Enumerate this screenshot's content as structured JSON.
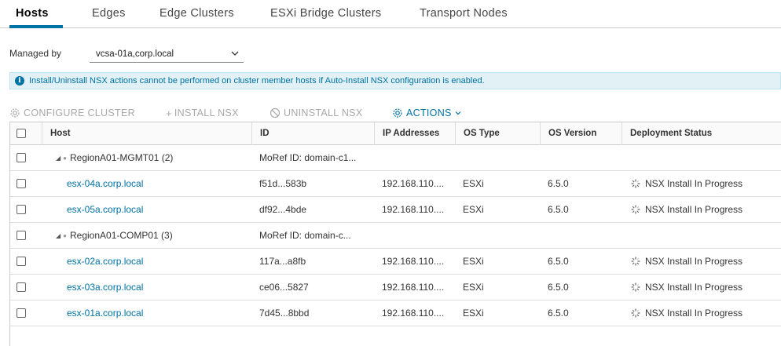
{
  "tabs": [
    {
      "label": "Hosts",
      "active": true
    },
    {
      "label": "Edges",
      "active": false
    },
    {
      "label": "Edge Clusters",
      "active": false
    },
    {
      "label": "ESXi Bridge Clusters",
      "active": false
    },
    {
      "label": "Transport Nodes",
      "active": false
    }
  ],
  "managed_by": {
    "label": "Managed by",
    "value": "vcsa-01a,corp.local",
    "chevron_icon": "chevron-down-icon"
  },
  "banner": {
    "icon": "info-icon",
    "message": "Install/Uninstall NSX actions cannot be performed on cluster member hosts if Auto-Install NSX configuration is enabled."
  },
  "toolbar": {
    "configure_cluster": "CONFIGURE CLUSTER",
    "install_nsx": "INSTALL NSX",
    "uninstall_nsx": "UNINSTALL NSX",
    "actions": "ACTIONS"
  },
  "columns": {
    "host": "Host",
    "id": "ID",
    "ip": "IP Addresses",
    "os_type": "OS Type",
    "os_version": "OS Version",
    "deployment_status": "Deployment Status"
  },
  "rows": [
    {
      "kind": "cluster",
      "host": "RegionA01-MGMT01 (2)",
      "id": "MoRef ID: domain-c1...",
      "ip": "",
      "os_type": "",
      "os_version": "",
      "status": ""
    },
    {
      "kind": "host",
      "host": "esx-04a.corp.local",
      "id": "f51d...583b",
      "ip": "192.168.110....",
      "os_type": "ESXi",
      "os_version": "6.5.0",
      "status": "NSX Install In Progress"
    },
    {
      "kind": "host",
      "host": "esx-05a.corp.local",
      "id": "df92...4bde",
      "ip": "192.168.110....",
      "os_type": "ESXi",
      "os_version": "6.5.0",
      "status": "NSX Install In Progress"
    },
    {
      "kind": "cluster",
      "host": "RegionA01-COMP01 (3)",
      "id": "MoRef ID: domain-c...",
      "ip": "",
      "os_type": "",
      "os_version": "",
      "status": ""
    },
    {
      "kind": "host",
      "host": "esx-02a.corp.local",
      "id": "117a...a8fb",
      "ip": "192.168.110....",
      "os_type": "ESXi",
      "os_version": "6.5.0",
      "status": "NSX Install In Progress"
    },
    {
      "kind": "host",
      "host": "esx-03a.corp.local",
      "id": "ce06...5827",
      "ip": "192.168.110....",
      "os_type": "ESXi",
      "os_version": "6.5.0",
      "status": "NSX Install In Progress"
    },
    {
      "kind": "host",
      "host": "esx-01a.corp.local",
      "id": "7d45...8bbd",
      "ip": "192.168.110....",
      "os_type": "ESXi",
      "os_version": "6.5.0",
      "status": "NSX Install In Progress"
    }
  ],
  "colors": {
    "accent": "#0072a3",
    "banner_bg": "#e1f1f6",
    "disabled": "#a8a8a8"
  }
}
